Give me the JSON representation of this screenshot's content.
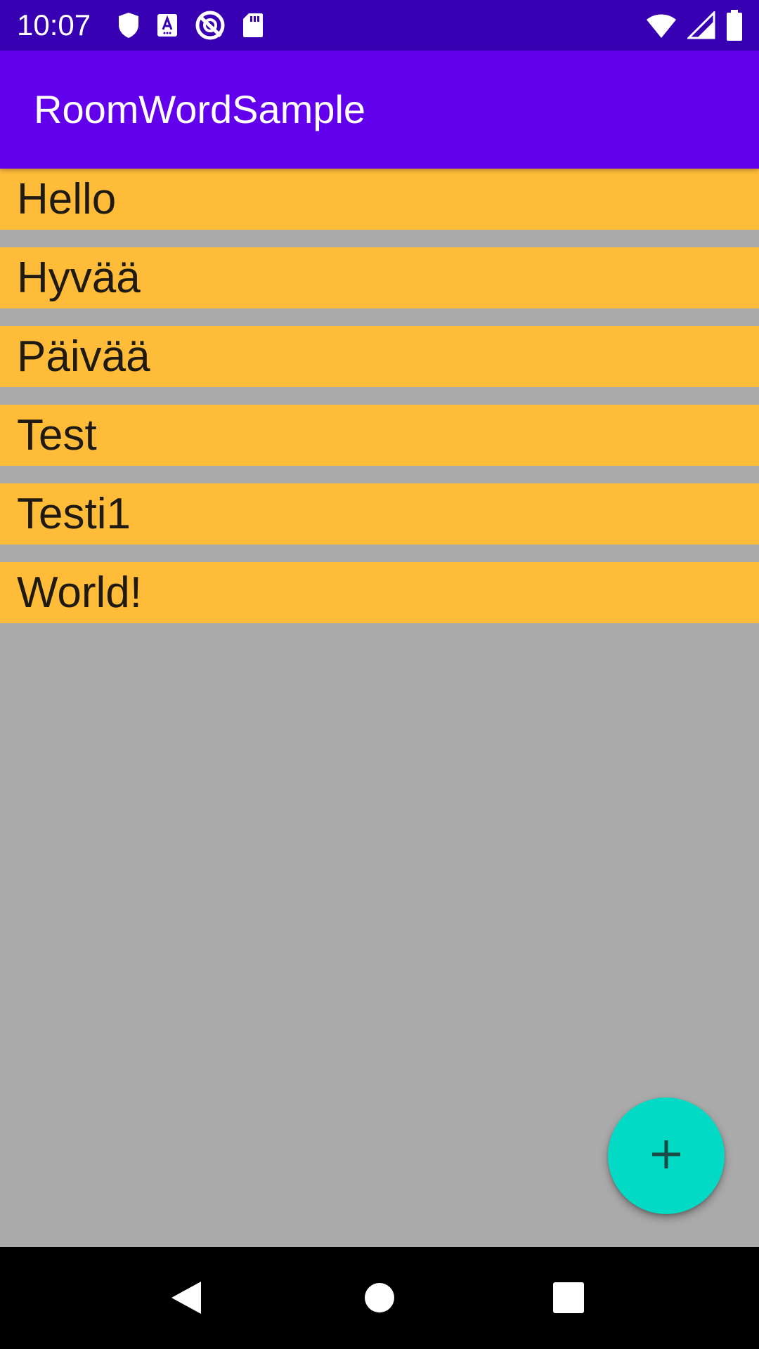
{
  "status_bar": {
    "time": "10:07",
    "icons_left": [
      "shield-icon",
      "font-a-icon",
      "no-sync-icon",
      "sd-card-icon"
    ],
    "icons_right": [
      "wifi-icon",
      "cell-signal-icon",
      "battery-icon"
    ]
  },
  "app_bar": {
    "title": "RoomWordSample",
    "color": "#6200ee"
  },
  "words": [
    {
      "text": "Hello"
    },
    {
      "text": "Hyvää"
    },
    {
      "text": "Päivää"
    },
    {
      "text": "Test"
    },
    {
      "text": "Testi1"
    },
    {
      "text": "World!"
    }
  ],
  "fab": {
    "icon": "plus-icon",
    "color": "#03dac5"
  },
  "nav_bar": {
    "icons": [
      "back-icon",
      "home-icon",
      "recents-icon"
    ]
  },
  "colors": {
    "status_bar": "#3700b3",
    "list_item": "#ffbc38",
    "background": "#aaaaaa"
  }
}
